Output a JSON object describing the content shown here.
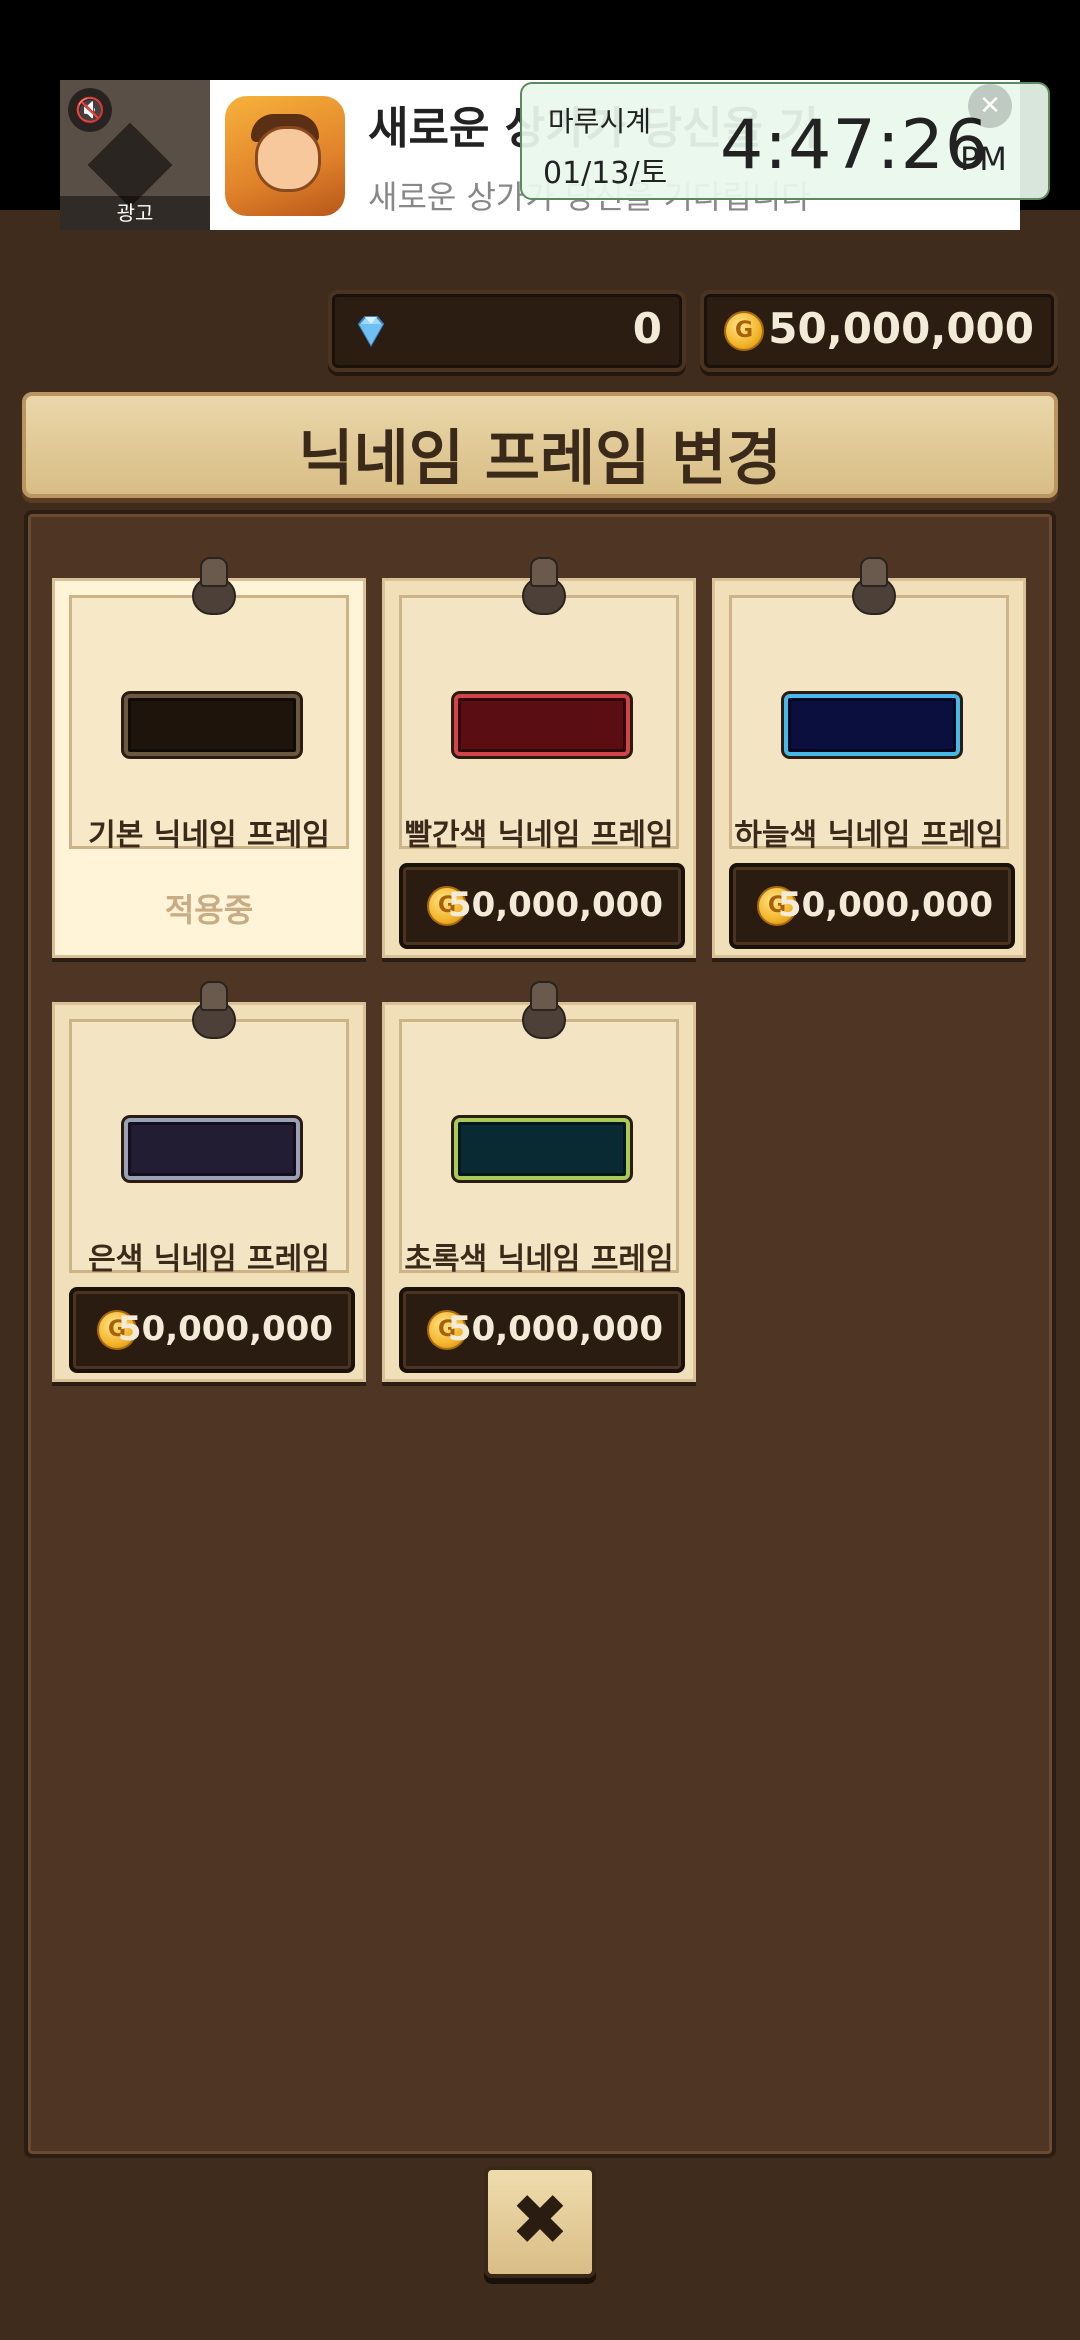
{
  "ad": {
    "label": "광고",
    "title": "새로운 상가가 당신을 기",
    "subtitle": "새로운 상가가 당신을 기다립니다"
  },
  "clock": {
    "name": "마루시계",
    "date": "01/13/토",
    "time": "4:47:26",
    "ampm": "PM"
  },
  "currency": {
    "gems": "0",
    "gold": "50,000,000"
  },
  "title": "닉네임 프레임 변경",
  "cards": [
    {
      "name": "기본 닉네임 프레임",
      "status": "적용중",
      "frame_fill": "#1e140c",
      "frame_border": "#6b5840"
    },
    {
      "name": "빨간색 닉네임 프레임",
      "price": "50,000,000",
      "frame_fill": "#5a0d12",
      "frame_border": "#d2444c"
    },
    {
      "name": "하늘색 닉네임 프레임",
      "price": "50,000,000",
      "frame_fill": "#0a0f3e",
      "frame_border": "#47b8e8"
    },
    {
      "name": "은색 닉네임 프레임",
      "price": "50,000,000",
      "frame_fill": "#231d33",
      "frame_border": "#9aa0b8"
    },
    {
      "name": "초록색 닉네임 프레임",
      "price": "50,000,000",
      "frame_fill": "#0a2a33",
      "frame_border": "#a9c95a"
    }
  ],
  "coin_symbol": "G",
  "close_symbol": "✖"
}
